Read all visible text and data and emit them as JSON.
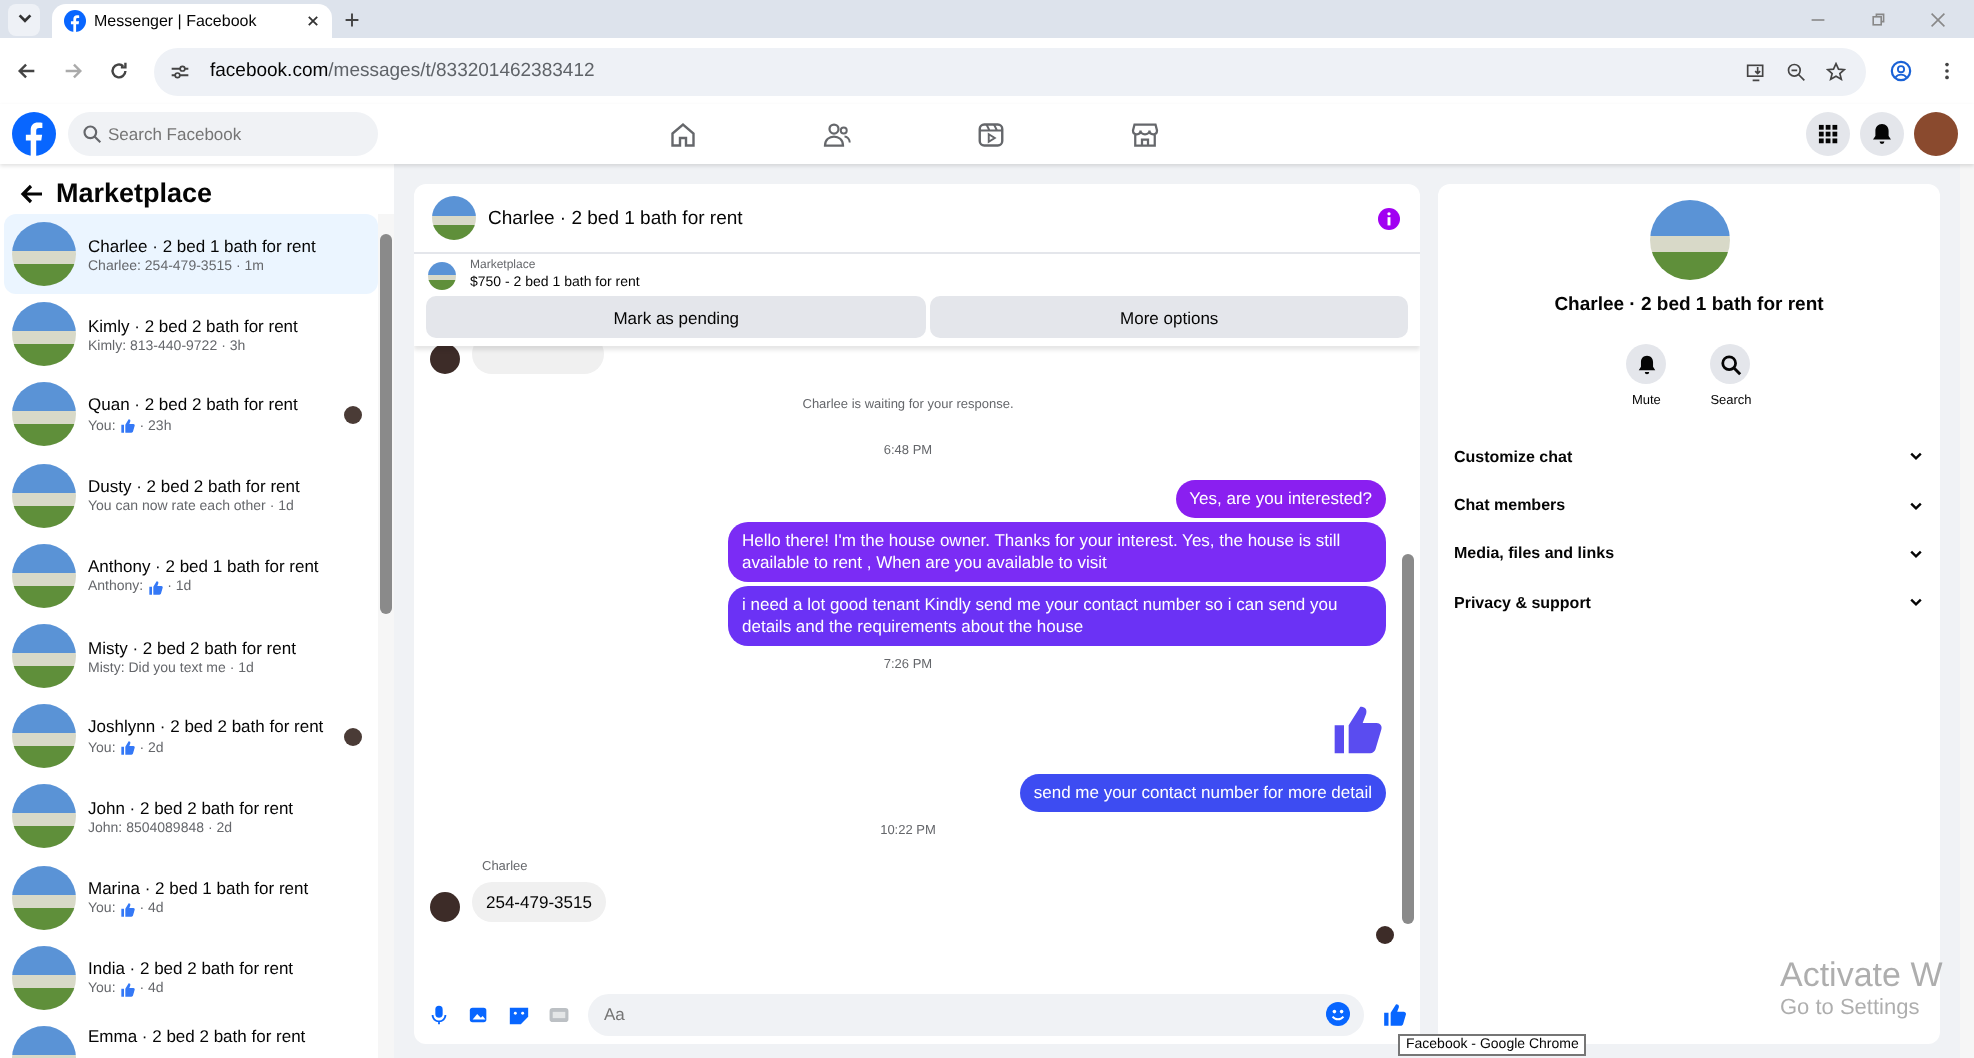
{
  "browser": {
    "tab_title": "Messenger | Facebook",
    "url_host": "facebook.com",
    "url_path": "/messages/t/833201462383412"
  },
  "header": {
    "search_placeholder": "Search Facebook",
    "nav": [
      {
        "kind": "home",
        "selected": false
      },
      {
        "kind": "friends",
        "selected": false
      },
      {
        "kind": "video",
        "selected": false
      },
      {
        "kind": "marketplace",
        "selected": false
      }
    ]
  },
  "sidebar": {
    "title": "Marketplace",
    "items": [
      {
        "title": "Charlee · 2 bed 1 bath for rent",
        "preview": "Charlee: 254-479-3515",
        "liked": false,
        "time": "· 1m",
        "seen": false,
        "selected": true
      },
      {
        "title": "Kimly · 2 bed 2 bath for rent",
        "preview": "Kimly: 813-440-9722",
        "liked": false,
        "time": "· 3h",
        "seen": false,
        "selected": false
      },
      {
        "title": "Quan · 2 bed 2 bath for rent",
        "preview": "You:",
        "liked": true,
        "time": "· 23h",
        "seen": true,
        "selected": false
      },
      {
        "title": "Dusty · 2 bed 2 bath for rent",
        "preview": "You can now rate each other",
        "liked": false,
        "time": "· 1d",
        "seen": false,
        "selected": false
      },
      {
        "title": "Anthony · 2 bed 1 bath for rent",
        "preview": "Anthony:",
        "liked": true,
        "time": "· 1d",
        "seen": false,
        "selected": false
      },
      {
        "title": "Misty · 2 bed 2 bath for rent",
        "preview": "Misty: Did you text me",
        "liked": false,
        "time": "· 1d",
        "seen": false,
        "selected": false
      },
      {
        "title": "Joshlynn · 2 bed 2 bath for rent",
        "preview": "You:",
        "liked": true,
        "time": "· 2d",
        "seen": true,
        "selected": false
      },
      {
        "title": "John · 2 bed 2 bath for rent",
        "preview": "John: 8504089848",
        "liked": false,
        "time": "· 2d",
        "seen": false,
        "selected": false
      },
      {
        "title": "Marina · 2 bed 1 bath for rent",
        "preview": "You:",
        "liked": true,
        "time": "· 4d",
        "seen": false,
        "selected": false
      },
      {
        "title": "India · 2 bed 2 bath for rent",
        "preview": "You:",
        "liked": true,
        "time": "· 4d",
        "seen": false,
        "selected": false
      },
      {
        "title": "Emma · 2 bed 2 bath for rent",
        "seen": false,
        "selected": false
      }
    ]
  },
  "chat": {
    "title": "Charlee · 2 bed 1 bath for rent",
    "listing_label": "Marketplace",
    "listing": "$750 - 2 bed 1 bath for rent",
    "buttons": [
      "Mark as pending",
      "More options"
    ],
    "messages": [
      {
        "kind": "clipped"
      },
      {
        "kind": "system",
        "text": "Charlee is waiting for your response."
      },
      {
        "kind": "time",
        "text": "6:48 PM"
      },
      {
        "kind": "outgoing",
        "text": "Yes, are you interested?",
        "color": "#8a1ff0"
      },
      {
        "kind": "outgoing",
        "text": "Hello there! I'm the house owner. Thanks for your interest. Yes, the house is still available to rent , When are you available to visit",
        "color": "#7b2cf5"
      },
      {
        "kind": "outgoing",
        "text": "i need a lot good tenant Kindly send me your contact number so i can send you details and the requirements about the house",
        "color": "#6b32f5"
      },
      {
        "kind": "time",
        "text": "7:26 PM"
      },
      {
        "kind": "like",
        "color": "#5a4cf0"
      },
      {
        "kind": "outgoing",
        "text": "send me your contact number for more detail",
        "color": "#3d4cf2"
      },
      {
        "kind": "time",
        "text": "10:22 PM"
      },
      {
        "kind": "incoming",
        "sender": "Charlee",
        "text": "254-479-3515"
      }
    ],
    "composer_placeholder": "Aa"
  },
  "details": {
    "title": "Charlee · 2 bed 1 bath for rent",
    "actions": [
      {
        "kind": "mute",
        "label": "Mute"
      },
      {
        "kind": "search",
        "label": "Search"
      }
    ],
    "sections": [
      {
        "label": "Customize chat",
        "expanded": false
      },
      {
        "label": "Chat members",
        "expanded": false
      },
      {
        "label": "Media, files and links",
        "expanded": false
      },
      {
        "label": "Privacy & support",
        "expanded": false
      }
    ]
  },
  "tooltip": "Facebook - Google Chrome",
  "os_notice": {
    "title": "Activate W",
    "subtitle": "Go to Settings"
  }
}
